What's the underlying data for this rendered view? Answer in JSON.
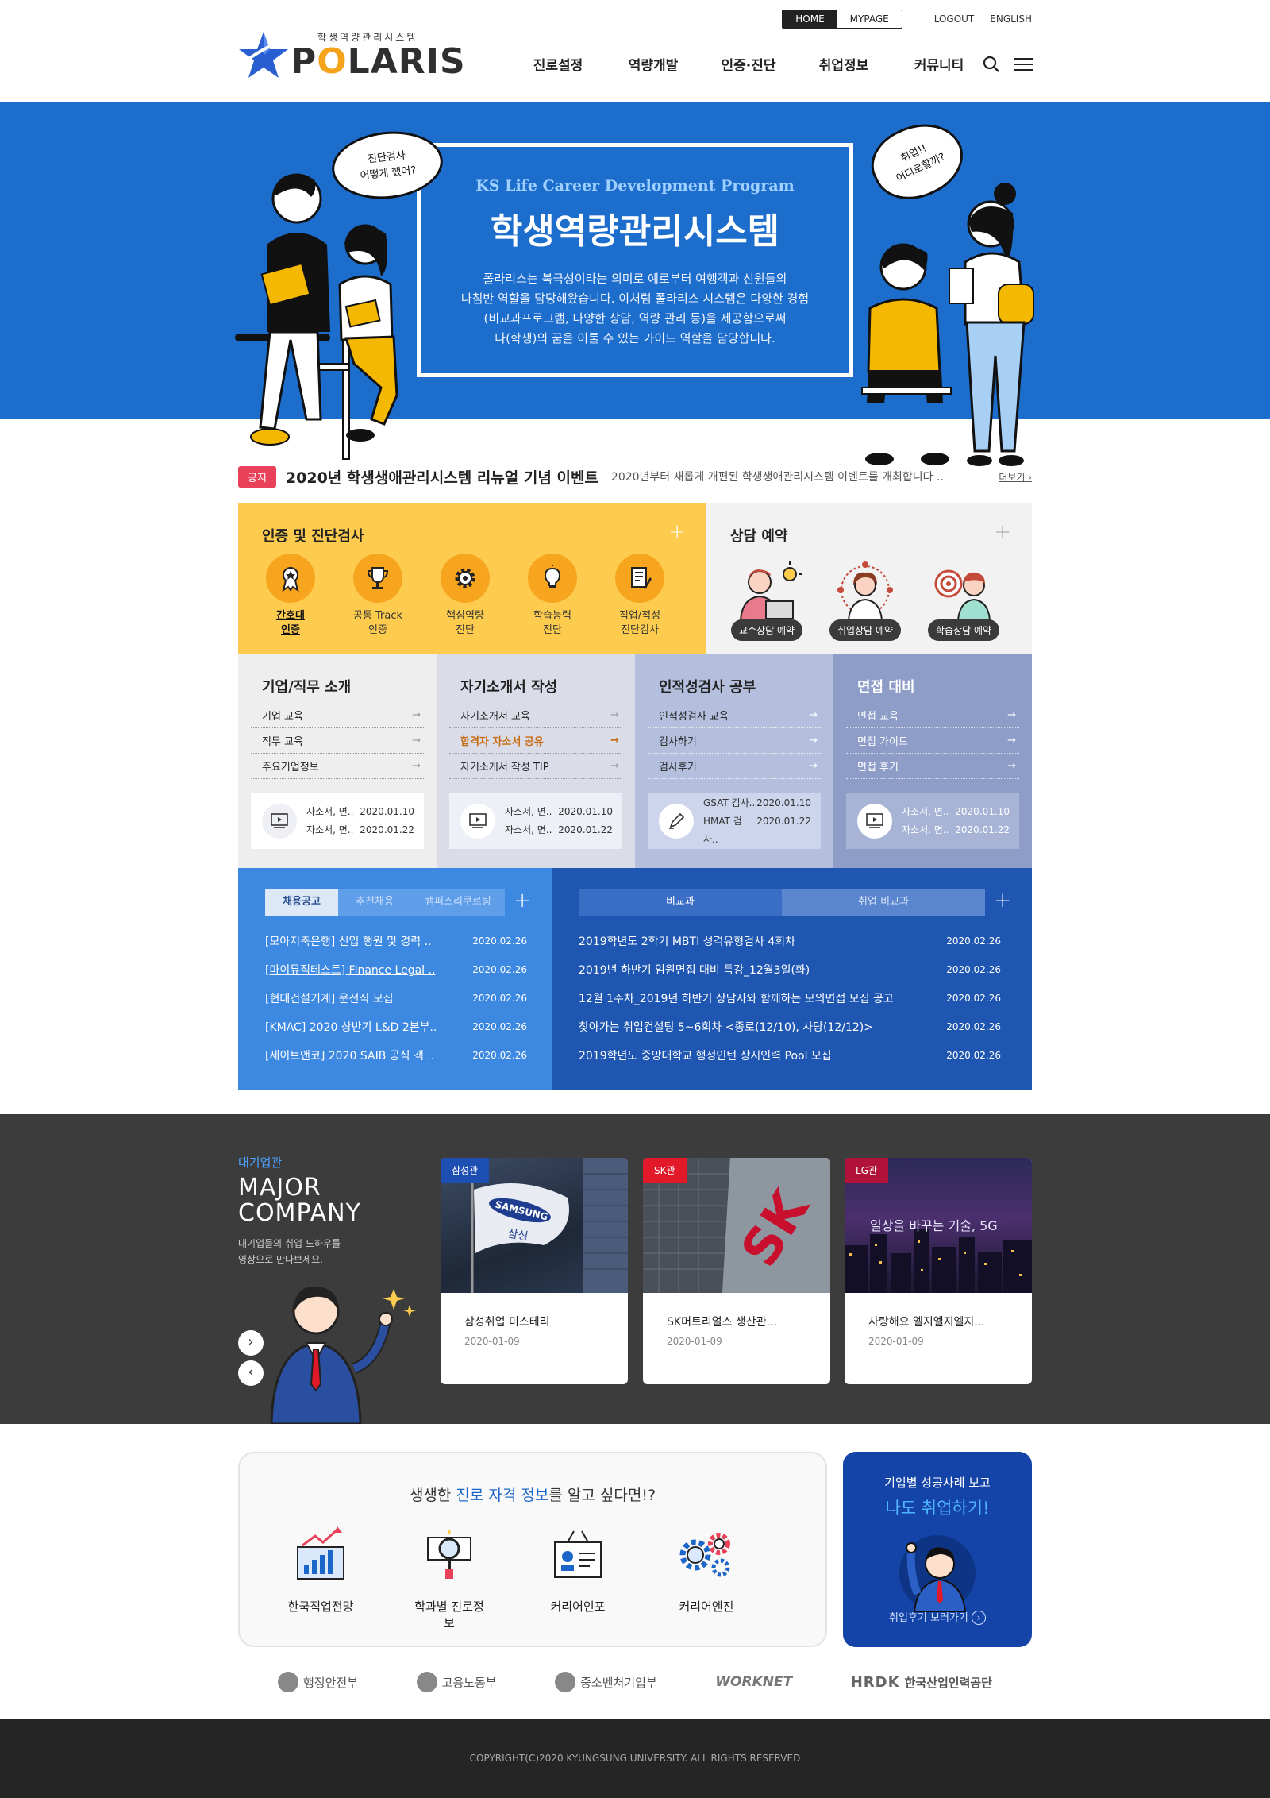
{
  "header": {
    "logo_sub": "학생역량관리시스템",
    "logo_text_pre": "P",
    "logo_text_o": "O",
    "logo_text_post": "LARIS",
    "top_links": {
      "home": "HOME",
      "mypage": "MYPAGE",
      "logout": "LOGOUT",
      "english": "ENGLISH"
    },
    "nav": [
      "진로설정",
      "역량개발",
      "인증·진단",
      "취업정보",
      "커뮤니티"
    ]
  },
  "hero": {
    "en_title": "KS Life Career Development Program",
    "ko_title": "학생역량관리시스템",
    "desc_lines": [
      "폴라리스는 북극성이라는 의미로 예로부터 여행객과 선원들의",
      "나침반 역할을 담당해왔습니다. 이처럼 폴라리스 시스템은 다양한 경험",
      "(비교과프로그램, 다양한 상담, 역량 관리 등)을 제공함으로써",
      "나(학생)의 꿈을 이룰 수 있는 가이드 역할을 담당합니다."
    ],
    "bubble_left": [
      "진단검사",
      "어떻게 했어?"
    ],
    "bubble_right": [
      "취업!!",
      "어디로할까?"
    ]
  },
  "notice": {
    "badge": "공지",
    "title": "2020년 학생생애관리시스템 리뉴얼 기념 이벤트",
    "desc": "2020년부터 새롭게 개편된 학생생애관리시스템 이벤트를 개최합니다 ..",
    "more": "더보기"
  },
  "cert": {
    "title": "인증 및 진단검사",
    "items": [
      {
        "l1": "간호대",
        "l2": "인증",
        "icon": "award-icon"
      },
      {
        "l1": "공통 Track",
        "l2": "인증",
        "icon": "trophy-icon"
      },
      {
        "l1": "핵심역량",
        "l2": "진단",
        "icon": "gear-icon"
      },
      {
        "l1": "학습능력",
        "l2": "진단",
        "icon": "lightbulb-icon"
      },
      {
        "l1": "직업/적성",
        "l2": "진단검사",
        "icon": "document-edit-icon"
      }
    ]
  },
  "counsel": {
    "title": "상담 예약",
    "items": [
      "교수상담 예약",
      "취업상담 예약",
      "학습상담 예약"
    ]
  },
  "columns": [
    {
      "title": "기업/직무 소개",
      "links": [
        "기업 교육",
        "직무 교육",
        "주요기업정보"
      ],
      "rows": [
        {
          "t": "자소서, 면..",
          "d": "2020.01.10"
        },
        {
          "t": "자소서, 면..",
          "d": "2020.01.22"
        }
      ]
    },
    {
      "title": "자기소개서 작성",
      "links": [
        "자기소개서 교육",
        "합격자 자소서 공유",
        "자기소개서 작성 TIP"
      ],
      "rows": [
        {
          "t": "자소서, 면..",
          "d": "2020.01.10"
        },
        {
          "t": "자소서, 면..",
          "d": "2020.01.22"
        }
      ]
    },
    {
      "title": "인적성검사 공부",
      "links": [
        "인적성검사 교육",
        "검사하기",
        "검사후기"
      ],
      "rows": [
        {
          "t": "GSAT 검사..",
          "d": "2020.01.10"
        },
        {
          "t": "HMAT 검사..",
          "d": "2020.01.22"
        }
      ]
    },
    {
      "title": "면접 대비",
      "links": [
        "면접 교육",
        "면접 가이드",
        "면접 후기"
      ],
      "rows": [
        {
          "t": "자소서, 면..",
          "d": "2020.01.10"
        },
        {
          "t": "자소서, 면..",
          "d": "2020.01.22"
        }
      ]
    }
  ],
  "jobs": {
    "tabs": [
      "채용공고",
      "추천채용",
      "캠퍼스리쿠르팅"
    ],
    "items": [
      {
        "t": "[모아저축은행] 신입 행원 및 경력 ..",
        "d": "2020.02.26"
      },
      {
        "t": "[마이뮤직테스트] Finance Legal ..",
        "d": "2020.02.26"
      },
      {
        "t": "[현대건설기계] 운전직 모집",
        "d": "2020.02.26"
      },
      {
        "t": "[KMAC] 2020 상반기 L&D 2본부..",
        "d": "2020.02.26"
      },
      {
        "t": "[세이브앤코] 2020 SAIB 공식 객 ..",
        "d": "2020.02.26"
      }
    ]
  },
  "compare": {
    "tabs": [
      "비교과",
      "취업 비교과"
    ],
    "items": [
      {
        "t": "2019학년도 2학기 MBTI 성격유형검사 4회차",
        "d": "2020.02.26"
      },
      {
        "t": "2019년 하반기 임원면접 대비 특강_12월3일(화)",
        "d": "2020.02.26"
      },
      {
        "t": "12월 1주차_2019년 하반기 상담사와 함께하는 모의면접 모집 공고",
        "d": "2020.02.26"
      },
      {
        "t": "찾아가는 취업컨설팅 5~6회차 <종로(12/10), 사당(12/12)>",
        "d": "2020.02.26"
      },
      {
        "t": "2019학년도 중앙대학교 행정인턴 상시인력 Pool 모집",
        "d": "2020.02.26"
      }
    ]
  },
  "major": {
    "tag": "대기업관",
    "title1": "MAJOR",
    "title2": "COMPANY",
    "desc1": "대기업들의 취업 노하우를",
    "desc2": "영상으로 만나보세요.",
    "cards": [
      {
        "tag": "삼성관",
        "caption": "삼성취업 미스테리",
        "date": "2020-01-09",
        "tag_color": "#1d4fb3",
        "flag1": "SAMSUNG",
        "flag2": "삼성"
      },
      {
        "tag": "SK관",
        "caption": "SK머트리얼스 생산관...",
        "date": "2020-01-09",
        "tag_color": "#e3192a",
        "sign": "SK"
      },
      {
        "tag": "LG관",
        "caption": "사랑해요 엘지엘지엘지...",
        "date": "2020-01-09",
        "tag_color": "#b0123a",
        "overlay": "일상을 바꾸는 기술, 5G"
      }
    ]
  },
  "career": {
    "q_pre": "생생한 ",
    "q_hl": "진로 자격 정보",
    "q_post": "를 알고 싶다면!?",
    "items": [
      "한국직업전망",
      "학과별 진로정보",
      "커리어인포",
      "커리어엔진"
    ]
  },
  "success": {
    "t1": "기업별 성공사례 보고",
    "t2": "나도 취업하기!",
    "t3": "취업후기 보러가기"
  },
  "partners": [
    "행정안전부",
    "고용노동부",
    "중소벤처기업부",
    "WORKNET",
    "한국산업인력공단"
  ],
  "partner_hrdk": "HRDK",
  "footer": "COPYRIGHT(C)2020 KYUNGSUNG UNIVERSITY. ALL RIGHTS RESERVED"
}
